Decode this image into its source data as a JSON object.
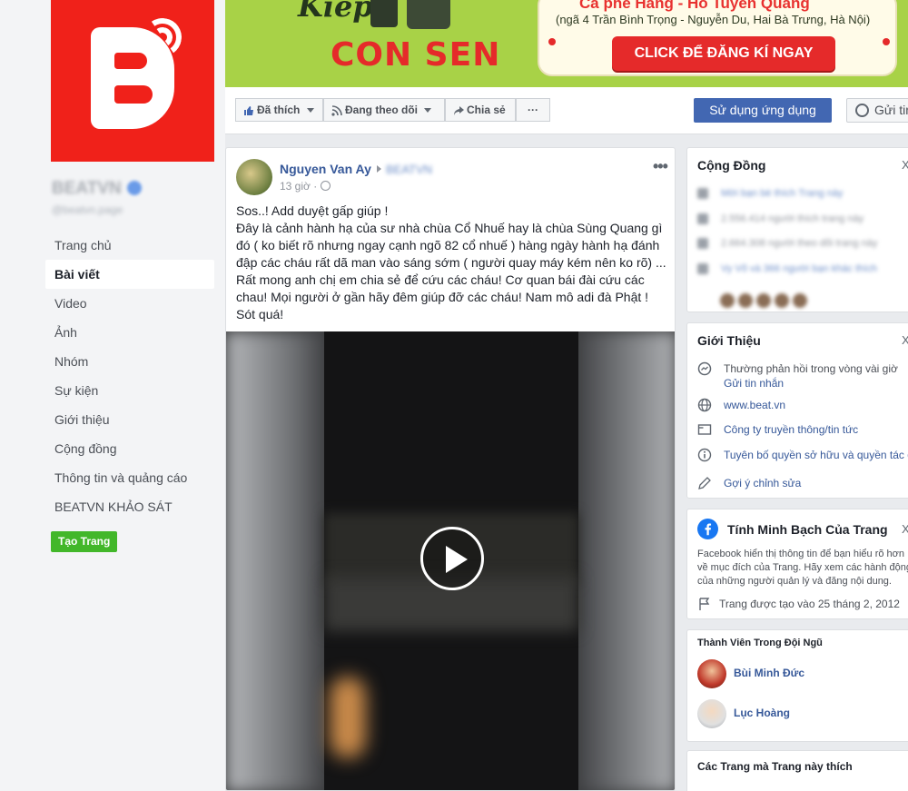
{
  "cover": {
    "kiep": "Kiếp",
    "con_sen": "CON SEN",
    "venue_title": "Cà phê Hàng - Hồ Tuyền Quang",
    "address": "(ngã 4 Trần Bình Trọng - Nguyễn Du, Hai Bà Trưng, Hà Nội)",
    "cta": "CLICK ĐỂ ĐĂNG KÍ NGAY"
  },
  "page": {
    "name": "BEATVN",
    "handle": "@beatvn.page"
  },
  "left_nav": {
    "items": [
      "Trang chủ",
      "Bài viết",
      "Video",
      "Ảnh",
      "Nhóm",
      "Sự kiện",
      "Giới thiệu",
      "Cộng đồng",
      "Thông tin và quảng cáo",
      "BEATVN KHẢO SÁT"
    ],
    "active": "Bài viết",
    "create_page": "Tạo Trang"
  },
  "action_bar": {
    "liked": "Đã thích",
    "following": "Đang theo dõi",
    "share": "Chia sẻ",
    "more": "···",
    "use_app": "Sử dụng ứng dụng",
    "send": "Gửi tin"
  },
  "post": {
    "author": "Nguyen Van Ay",
    "target": "BEATVN",
    "time": "13 giờ ·",
    "options": "•••",
    "body": "Sos..! Add duyệt gấp giúp !\nĐây là cảnh hành hạ của sư nhà chùa Cổ Nhuế hay là chùa Sùng Quang gì đó ( ko biết rõ nhưng ngay cạnh ngõ 82 cổ nhuế ) hàng ngày hành hạ đánh đập các cháu rất dã man vào sáng sớm ( người quay máy kém nên ko rõ) ...\nRất mong anh chị em chia sẻ để cứu các cháu! Cơ quan bái đài cứu các chau! Mọi người ở gần hãy đêm giúp đỡ các cháu! Nam mô adi đà Phật !\nSót quá!"
  },
  "community": {
    "title": "Cộng Đồng",
    "close": "X",
    "rows": [
      "Mời bạn bè thích Trang này",
      "2.556.414 người thích trang này",
      "2.664.308 người theo dõi trang này",
      "Vy Võ và 366 người bạn khác thích"
    ]
  },
  "about": {
    "title": "Giới Thiệu",
    "close": "X",
    "response": "Thường phản hồi trong vòng vài giờ",
    "send_message": "Gửi tin nhắn",
    "website": "www.beat.vn",
    "category": "Công ty truyền thông/tin tức",
    "ownership": "Tuyên bố quyền sở hữu và quyền tác giả",
    "suggest_edit": "Gợi ý chỉnh sửa"
  },
  "transparency": {
    "title": "Tính Minh Bạch Của Trang",
    "close": "X",
    "desc": "Facebook hiển thị thông tin để bạn hiểu rõ hơn về mục đích của Trang. Hãy xem các hành động của những người quản lý và đăng nội dung.",
    "created": "Trang được tạo vào 25 tháng 2, 2012"
  },
  "team": {
    "title": "Thành Viên Trong Đội Ngũ",
    "members": [
      "Bùi Minh Đức",
      "Lục Hoàng"
    ]
  },
  "liked_pages": {
    "title": "Các Trang mà Trang này thích"
  }
}
